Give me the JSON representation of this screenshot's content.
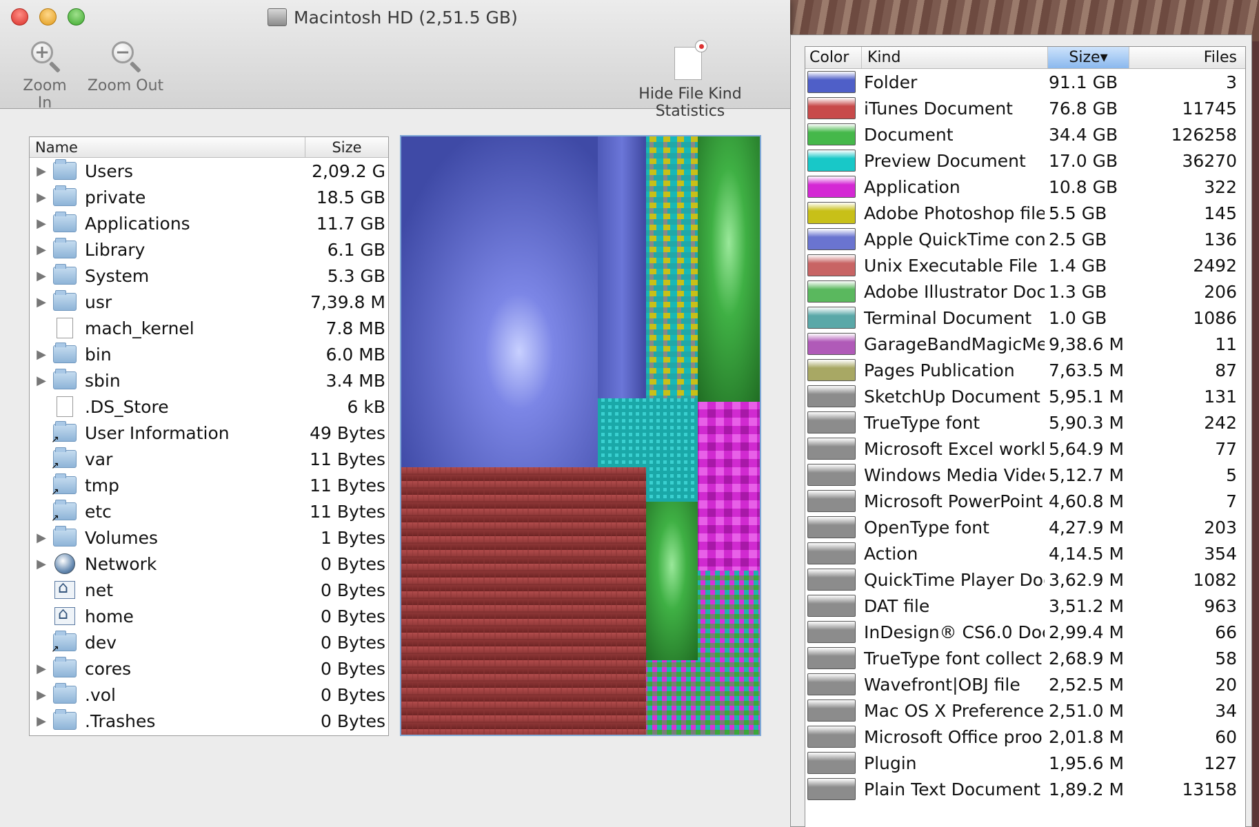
{
  "window": {
    "title": "Macintosh HD (2,51.5 GB)"
  },
  "toolbar": {
    "zoom_in": "Zoom In",
    "zoom_out": "Zoom Out",
    "hide_stats": "Hide File Kind Statistics"
  },
  "file_list": {
    "header_name": "Name",
    "header_size": "Size",
    "rows": [
      {
        "name": "Users",
        "size": "2,09.2 G",
        "icon": "users-folder-icon",
        "expandable": true
      },
      {
        "name": "private",
        "size": "18.5 GB",
        "icon": "folder-icon",
        "expandable": true
      },
      {
        "name": "Applications",
        "size": "11.7 GB",
        "icon": "applications-folder-icon",
        "expandable": true
      },
      {
        "name": "Library",
        "size": "6.1 GB",
        "icon": "library-folder-icon",
        "expandable": true
      },
      {
        "name": "System",
        "size": "5.3 GB",
        "icon": "system-folder-icon",
        "expandable": true
      },
      {
        "name": "usr",
        "size": "7,39.8 M",
        "icon": "folder-icon",
        "expandable": true
      },
      {
        "name": "mach_kernel",
        "size": "7.8 MB",
        "icon": "file-icon",
        "expandable": false
      },
      {
        "name": "bin",
        "size": "6.0 MB",
        "icon": "folder-icon",
        "expandable": true
      },
      {
        "name": "sbin",
        "size": "3.4 MB",
        "icon": "folder-icon",
        "expandable": true
      },
      {
        "name": ".DS_Store",
        "size": "6 kB",
        "icon": "file-icon",
        "expandable": false
      },
      {
        "name": "User Information",
        "size": "49 Bytes",
        "icon": "alias-folder-icon",
        "expandable": false
      },
      {
        "name": "var",
        "size": "11 Bytes",
        "icon": "alias-folder-icon",
        "expandable": false
      },
      {
        "name": "tmp",
        "size": "11 Bytes",
        "icon": "alias-folder-icon",
        "expandable": false
      },
      {
        "name": "etc",
        "size": "11 Bytes",
        "icon": "alias-folder-icon",
        "expandable": false
      },
      {
        "name": "Volumes",
        "size": "1 Bytes",
        "icon": "folder-icon",
        "expandable": true
      },
      {
        "name": "Network",
        "size": "0 Bytes",
        "icon": "globe-icon",
        "expandable": true
      },
      {
        "name": "net",
        "size": "0 Bytes",
        "icon": "network-share-icon",
        "expandable": false
      },
      {
        "name": "home",
        "size": "0 Bytes",
        "icon": "network-share-icon",
        "expandable": false
      },
      {
        "name": "dev",
        "size": "0 Bytes",
        "icon": "alias-folder-icon",
        "expandable": false
      },
      {
        "name": "cores",
        "size": "0 Bytes",
        "icon": "folder-icon",
        "expandable": true
      },
      {
        "name": ".vol",
        "size": "0 Bytes",
        "icon": "folder-icon",
        "expandable": true
      },
      {
        "name": ".Trashes",
        "size": "0 Bytes",
        "icon": "trash-folder-icon",
        "expandable": true
      }
    ]
  },
  "colors": {
    "folder": "#4f5fc8",
    "itunes": "#c84a4a",
    "document": "#45b84a",
    "preview": "#18c8c8",
    "application": "#d428d4",
    "photoshop": "#c8c018",
    "quicktime": "#6a74d0",
    "unix": "#c86464",
    "illustrator": "#5ab85e",
    "terminal": "#5aa8a8",
    "garageband": "#b05ab8",
    "pages": "#a8a864",
    "gray": "#8c8c8c"
  },
  "stats": {
    "header_color": "Color",
    "header_kind": "Kind",
    "header_size": "Size",
    "header_files": "Files",
    "sort_indicator": "▾",
    "rows": [
      {
        "kind": "Folder",
        "size": "91.1 GB",
        "files": "3",
        "color": "#4f5fc8"
      },
      {
        "kind": "iTunes Document",
        "size": "76.8 GB",
        "files": "11745",
        "color": "#c84a4a"
      },
      {
        "kind": "Document",
        "size": "34.4 GB",
        "files": "126258",
        "color": "#45b84a"
      },
      {
        "kind": "Preview Document",
        "size": "17.0 GB",
        "files": "36270",
        "color": "#18c8c8"
      },
      {
        "kind": "Application",
        "size": "10.8 GB",
        "files": "322",
        "color": "#d428d4"
      },
      {
        "kind": "Adobe Photoshop file",
        "size": "5.5 GB",
        "files": "145",
        "color": "#c8c018"
      },
      {
        "kind": "Apple QuickTime con",
        "size": "2.5 GB",
        "files": "136",
        "color": "#6a74d0"
      },
      {
        "kind": "Unix Executable File",
        "size": "1.4 GB",
        "files": "2492",
        "color": "#c86464"
      },
      {
        "kind": "Adobe Illustrator Doc",
        "size": "1.3 GB",
        "files": "206",
        "color": "#5ab85e"
      },
      {
        "kind": "Terminal Document",
        "size": "1.0 GB",
        "files": "1086",
        "color": "#5aa8a8"
      },
      {
        "kind": "GarageBandMagicMe",
        "size": "9,38.6 M",
        "files": "11",
        "color": "#b05ab8"
      },
      {
        "kind": "Pages Publication",
        "size": "7,63.5 M",
        "files": "87",
        "color": "#a8a864"
      },
      {
        "kind": "SketchUp Document",
        "size": "5,95.1 M",
        "files": "131",
        "color": "#8c8c8c"
      },
      {
        "kind": "TrueType font",
        "size": "5,90.3 M",
        "files": "242",
        "color": "#8c8c8c"
      },
      {
        "kind": "Microsoft Excel workl",
        "size": "5,64.9 M",
        "files": "77",
        "color": "#8c8c8c"
      },
      {
        "kind": "Windows Media Videc",
        "size": "5,12.7 M",
        "files": "5",
        "color": "#8c8c8c"
      },
      {
        "kind": "Microsoft PowerPoint",
        "size": "4,60.8 M",
        "files": "7",
        "color": "#8c8c8c"
      },
      {
        "kind": "OpenType font",
        "size": "4,27.9 M",
        "files": "203",
        "color": "#8c8c8c"
      },
      {
        "kind": "Action",
        "size": "4,14.5 M",
        "files": "354",
        "color": "#8c8c8c"
      },
      {
        "kind": "QuickTime Player Doc",
        "size": "3,62.9 M",
        "files": "1082",
        "color": "#8c8c8c"
      },
      {
        "kind": "DAT file",
        "size": "3,51.2 M",
        "files": "963",
        "color": "#8c8c8c"
      },
      {
        "kind": "InDesign® CS6.0 Doc",
        "size": "2,99.4 M",
        "files": "66",
        "color": "#8c8c8c"
      },
      {
        "kind": "TrueType font collect",
        "size": "2,68.9 M",
        "files": "58",
        "color": "#8c8c8c"
      },
      {
        "kind": "Wavefront|OBJ file",
        "size": "2,52.5 M",
        "files": "20",
        "color": "#8c8c8c"
      },
      {
        "kind": "Mac OS X Preference",
        "size": "2,51.0 M",
        "files": "34",
        "color": "#8c8c8c"
      },
      {
        "kind": "Microsoft Office proo",
        "size": "2,01.8 M",
        "files": "60",
        "color": "#8c8c8c"
      },
      {
        "kind": "Plugin",
        "size": "1,95.6 M",
        "files": "127",
        "color": "#8c8c8c"
      },
      {
        "kind": "Plain Text Document",
        "size": "1,89.2 M",
        "files": "13158",
        "color": "#8c8c8c"
      }
    ]
  }
}
